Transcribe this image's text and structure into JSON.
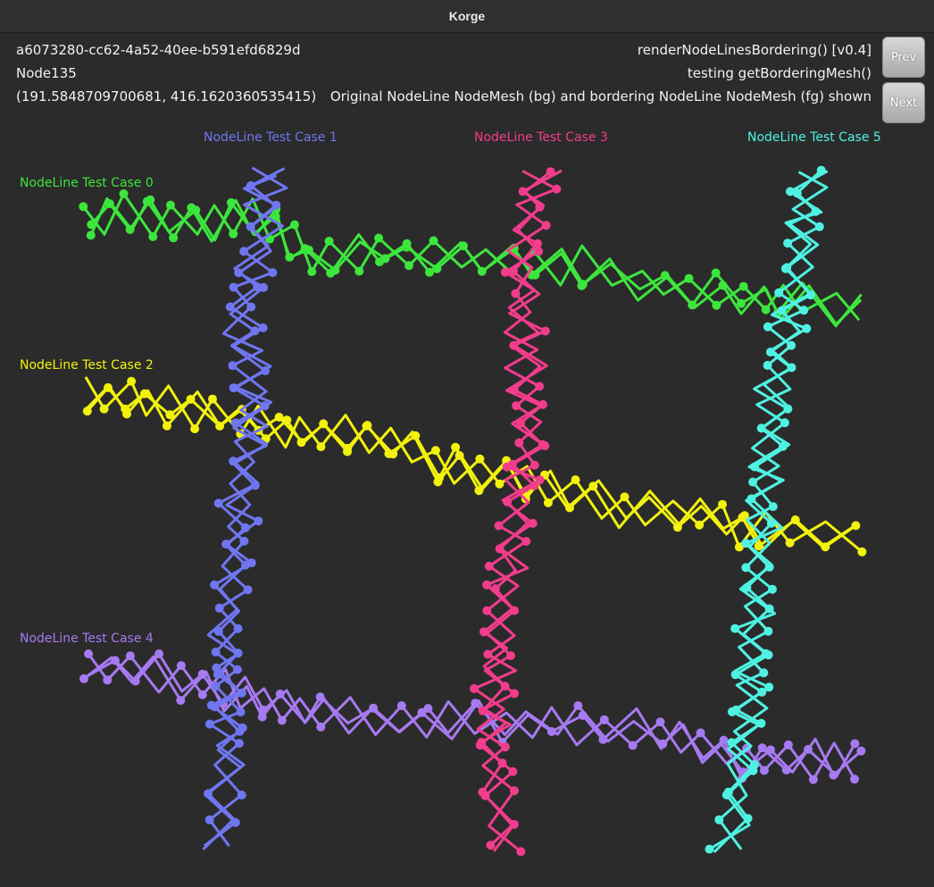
{
  "window": {
    "title": "Korge"
  },
  "info": {
    "id": "a6073280-cc62-4a52-40ee-b591efd6829d",
    "node": "Node135",
    "coords": "(191.5848709700681, 416.1620360535415)",
    "version": "renderNodeLinesBordering() [v0.4]",
    "testing": "testing getBorderingMesh()",
    "description": "Original NodeLine NodeMesh (bg) and bordering NodeLine NodeMesh (fg) shown"
  },
  "buttons": {
    "prev": "Prev",
    "next": "Next"
  },
  "labels": {
    "case0": "NodeLine Test Case 0",
    "case1": "NodeLine Test Case 1",
    "case2": "NodeLine Test Case 2",
    "case3": "NodeLine Test Case 3",
    "case4": "NodeLine Test Case 4",
    "case5": "NodeLine Test Case 5"
  },
  "colors": {
    "case0": "#3de63d",
    "case1": "#7076f0",
    "case2": "#f2f20e",
    "case3": "#f23c8c",
    "case4": "#a67af0",
    "case5": "#4ff2e2",
    "background": "#2b2b2b"
  }
}
